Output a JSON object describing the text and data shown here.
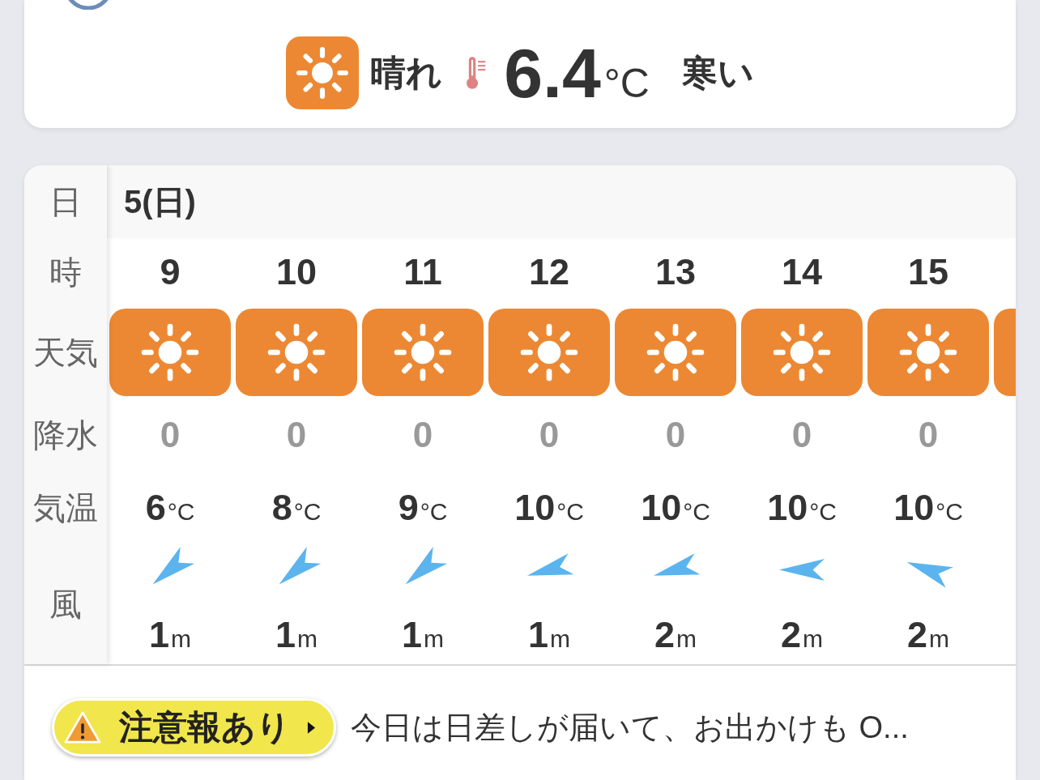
{
  "current": {
    "kind": "sunny",
    "condition": "晴れ",
    "temperature": "6.4",
    "unit": "°C",
    "feeling": "寒い"
  },
  "forecast": {
    "row_labels": [
      "日",
      "時",
      "天気",
      "降水",
      "気温",
      "風"
    ],
    "date": "5(日)",
    "hours": [
      {
        "kind": "sunny",
        "hour": "9",
        "precipitation": "0",
        "temperature": "6",
        "temp_unit": "°C",
        "wind": {
          "kind": "NE",
          "speed": "1",
          "unit": "m"
        }
      },
      {
        "kind": "sunny",
        "hour": "10",
        "precipitation": "0",
        "temperature": "8",
        "temp_unit": "°C",
        "wind": {
          "kind": "NE",
          "speed": "1",
          "unit": "m"
        }
      },
      {
        "kind": "sunny",
        "hour": "11",
        "precipitation": "0",
        "temperature": "9",
        "temp_unit": "°C",
        "wind": {
          "kind": "NE",
          "speed": "1",
          "unit": "m"
        }
      },
      {
        "kind": "sunny",
        "hour": "12",
        "precipitation": "0",
        "temperature": "10",
        "temp_unit": "°C",
        "wind": {
          "kind": "ENE",
          "speed": "1",
          "unit": "m"
        }
      },
      {
        "kind": "sunny",
        "hour": "13",
        "precipitation": "0",
        "temperature": "10",
        "temp_unit": "°C",
        "wind": {
          "kind": "ENE",
          "speed": "2",
          "unit": "m"
        }
      },
      {
        "kind": "sunny",
        "hour": "14",
        "precipitation": "0",
        "temperature": "10",
        "temp_unit": "°C",
        "wind": {
          "kind": "E",
          "speed": "2",
          "unit": "m"
        }
      },
      {
        "kind": "sunny",
        "hour": "15",
        "precipitation": "0",
        "temperature": "10",
        "temp_unit": "°C",
        "wind": {
          "kind": "ESE",
          "speed": "2",
          "unit": "m"
        }
      },
      {
        "kind": "sunny"
      }
    ]
  },
  "warning": {
    "label": "注意報あり",
    "message": "今日は日差しが届いて、お出かけも O..."
  }
}
